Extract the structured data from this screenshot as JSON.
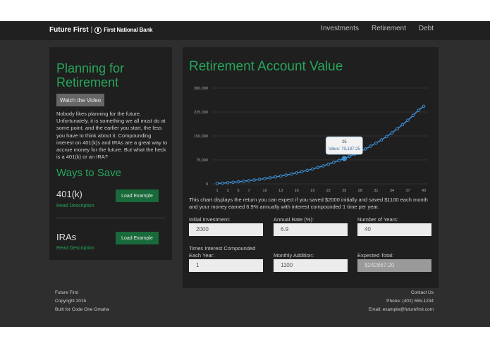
{
  "header": {
    "brand": "Future First",
    "separator": "|",
    "bank": "First National Bank",
    "nav": [
      "Investments",
      "Retirement",
      "Debt"
    ]
  },
  "sidebar": {
    "title": "Planning for Retirement",
    "video_button": "Watch the Video",
    "intro": "Nobody likes planning for the future. Unfortunately, it is something we all must do at some point, and the earlier you start, the less you have to think about it. Compounding interest on 401(k)s and IRAs are a great way to accrue money for the future. But what the heck is a 401(k) or an IRA?",
    "ways_title": "Ways to Save",
    "items": [
      {
        "title": "401(k)",
        "link": "Read Description",
        "button": "Load Example"
      },
      {
        "title": "IRAs",
        "link": "Read Description",
        "button": "Load Example"
      }
    ]
  },
  "main": {
    "title": "Retirement Account Value",
    "description": "This chart displays the return you can expect if you saved $2000 initially and saved $1100 each month and your money earned 6.9% annually with interest compounded 1 time per year.",
    "fields": {
      "initial": {
        "label": "Initial Investment:",
        "value": "2000"
      },
      "rate": {
        "label": "Annual Rate (%):",
        "value": "6.9"
      },
      "years": {
        "label": "Number of Years:",
        "value": "40"
      },
      "compound": {
        "label": "Times Interest Compounded Each Year:",
        "value": "1"
      },
      "monthly": {
        "label": "Monthly Addition:",
        "value": "1100"
      },
      "total": {
        "label": "Expected Total:",
        "value": "$242867.20"
      }
    }
  },
  "chart_data": {
    "type": "line",
    "title": "",
    "xlabel": "",
    "ylabel": "",
    "ylim": [
      0,
      300000
    ],
    "yticks": [
      "0",
      "75,000",
      "150,000",
      "225,000",
      "300,000"
    ],
    "xticks": [
      "1",
      "3",
      "5",
      "7",
      "10",
      "13",
      "16",
      "19",
      "22",
      "25",
      "28",
      "31",
      "34",
      "37",
      "40"
    ],
    "x": [
      1,
      2,
      3,
      4,
      5,
      6,
      7,
      8,
      9,
      10,
      11,
      12,
      13,
      14,
      15,
      16,
      17,
      18,
      19,
      20,
      21,
      22,
      23,
      24,
      25,
      26,
      27,
      28,
      29,
      30,
      31,
      32,
      33,
      34,
      35,
      36,
      37,
      38,
      39,
      40
    ],
    "values": [
      1000,
      2200,
      3500,
      4900,
      6500,
      8200,
      10100,
      12100,
      14200,
      16500,
      19000,
      21700,
      24600,
      27600,
      30900,
      34400,
      38200,
      42300,
      46600,
      51300,
      56300,
      61700,
      67400,
      73500,
      79187,
      86300,
      93500,
      101200,
      109400,
      118200,
      127600,
      137700,
      148400,
      159900,
      172200,
      185300,
      199300,
      214300,
      230300,
      242867
    ],
    "tooltip": {
      "title": "25",
      "value": "Value: 79,187.25"
    },
    "colors": {
      "line": "#3b8fd4",
      "grid": "#444444"
    }
  },
  "footer": {
    "left": [
      "Future First",
      "Copyright 2015",
      "Built for Code One Omaha"
    ],
    "right": [
      "Contact Us",
      "Phone: (402) 555-1234",
      "Email: example@futurefirst.com"
    ]
  }
}
